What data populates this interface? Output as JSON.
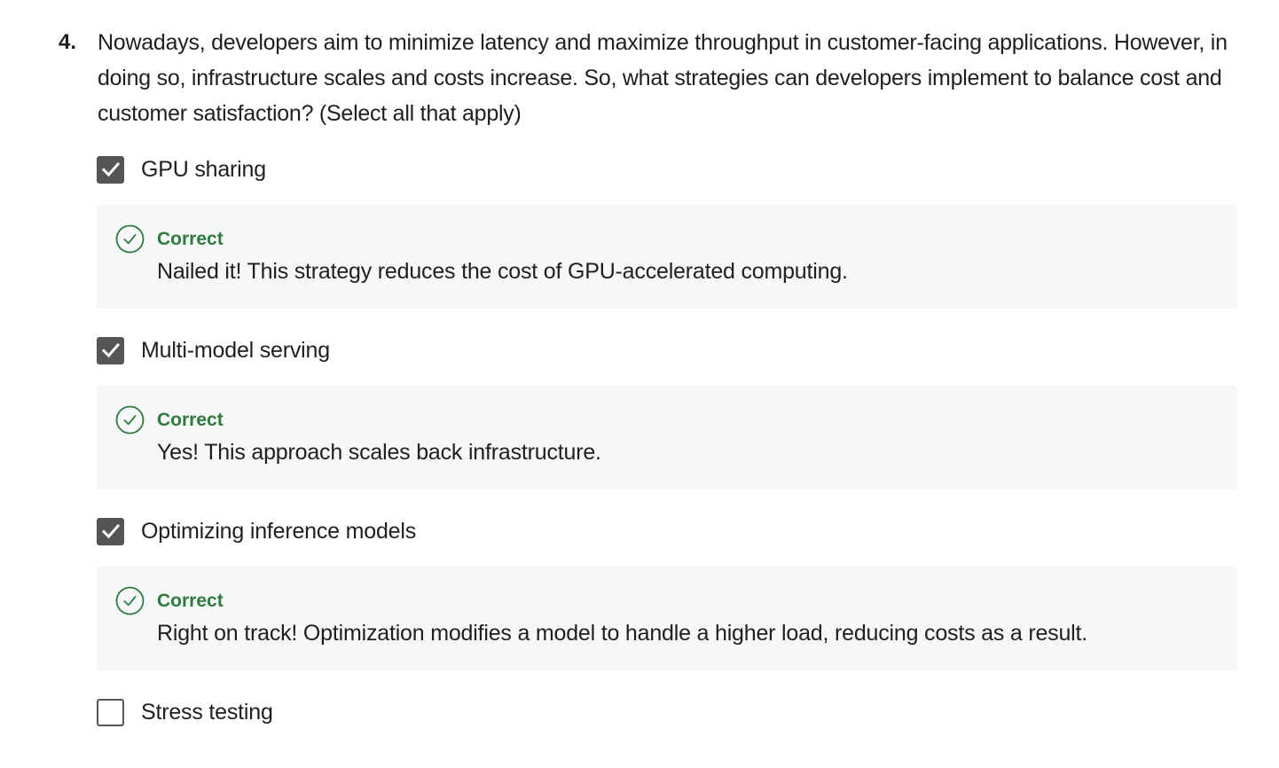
{
  "question": {
    "number": "4.",
    "text": "Nowadays, developers aim to minimize latency and maximize throughput in customer-facing applications. However, in doing so, infrastructure scales and costs increase. So, what strategies can developers implement to balance cost and customer satisfaction? (Select all that apply)"
  },
  "options": [
    {
      "label": "GPU sharing",
      "checked": true,
      "feedback": {
        "status": "Correct",
        "message": "Nailed it! This strategy reduces the cost of GPU-accelerated computing."
      }
    },
    {
      "label": "Multi-model serving",
      "checked": true,
      "feedback": {
        "status": "Correct",
        "message": "Yes! This approach scales back infrastructure."
      }
    },
    {
      "label": "Optimizing inference models",
      "checked": true,
      "feedback": {
        "status": "Correct",
        "message": "Right on track! Optimization modifies a model to handle a higher load, reducing costs as a result."
      }
    },
    {
      "label": "Stress testing",
      "checked": false
    }
  ],
  "colors": {
    "correct": "#2f7a3e",
    "checkbox": "#555555",
    "feedback_bg": "#f5f7f8"
  },
  "icons": {
    "checked": "checkmark-icon",
    "correct": "check-circle-icon"
  }
}
